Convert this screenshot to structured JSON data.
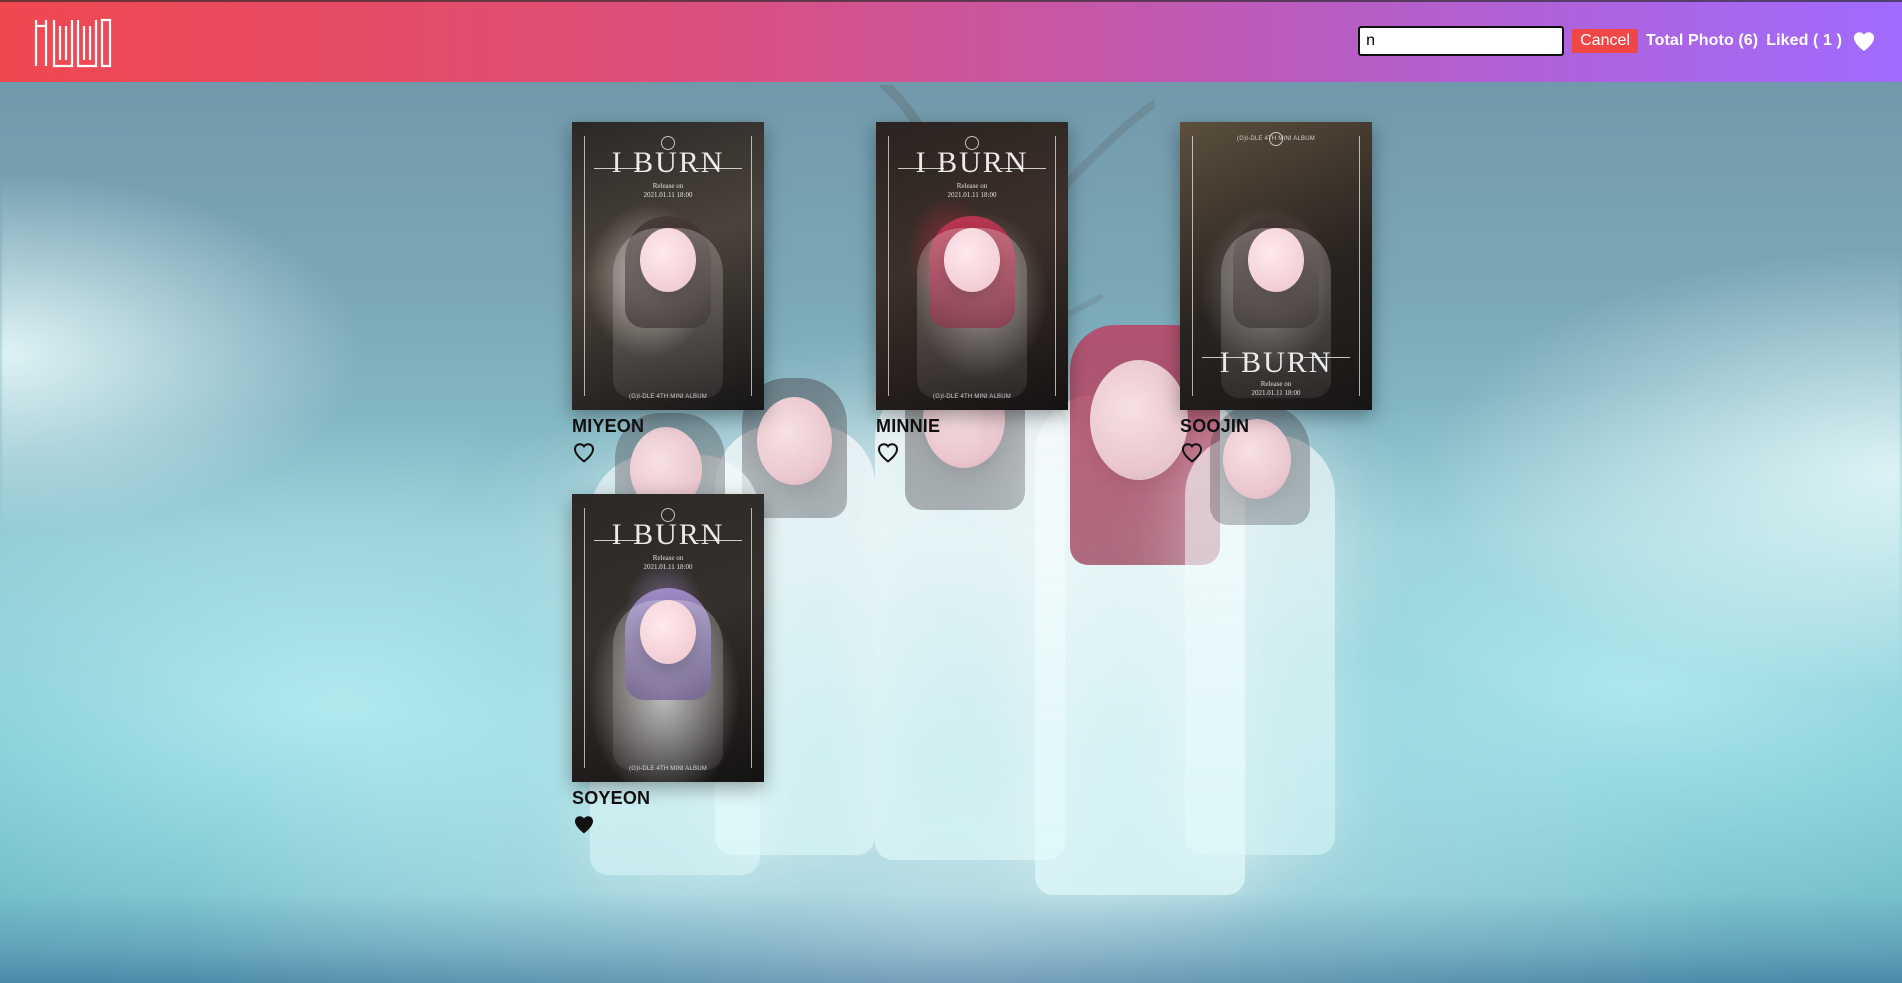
{
  "header": {
    "logo_text": "(G)I-DLE",
    "search": {
      "value": "n",
      "placeholder": ""
    },
    "cancel_label": "Cancel",
    "total_photo_text": "Total Photo (6)",
    "liked_text": "Liked ( 1 )",
    "liked_icon": "heart-icon"
  },
  "gallery": {
    "items": [
      {
        "name": "MIYEON",
        "liked": false,
        "poster_theme": "miyeon",
        "poster_text": {
          "title": "I BURN",
          "release_label": "Release on",
          "release_datetime": "2021.01.11 18:00",
          "footer": "(G)I-DLE 4TH MINI ALBUM"
        }
      },
      {
        "name": "MINNIE",
        "liked": false,
        "poster_theme": "minnie",
        "poster_text": {
          "title": "I BURN",
          "release_label": "Release on",
          "release_datetime": "2021.01.11 18:00",
          "footer": "(G)I-DLE 4TH MINI ALBUM"
        }
      },
      {
        "name": "SOOJIN",
        "liked": false,
        "poster_theme": "soojin",
        "poster_text": {
          "title": "I BURN",
          "release_label": "Release on",
          "release_datetime": "2021.01.11 18:00",
          "footer": "(G)I-DLE 4TH MINI ALBUM"
        }
      },
      {
        "name": "SOYEON",
        "liked": true,
        "poster_theme": "soyeon",
        "poster_text": {
          "title": "I BURN",
          "release_label": "Release on",
          "release_datetime": "2021.01.11 18:00",
          "footer": "(G)I-DLE 4TH MINI ALBUM"
        }
      }
    ]
  },
  "colors": {
    "header_left": "#f0484f",
    "header_mid": "#dd4f7b",
    "header_right": "#a06bff",
    "cancel_bg": "#f04646",
    "text_dark": "#111111"
  }
}
